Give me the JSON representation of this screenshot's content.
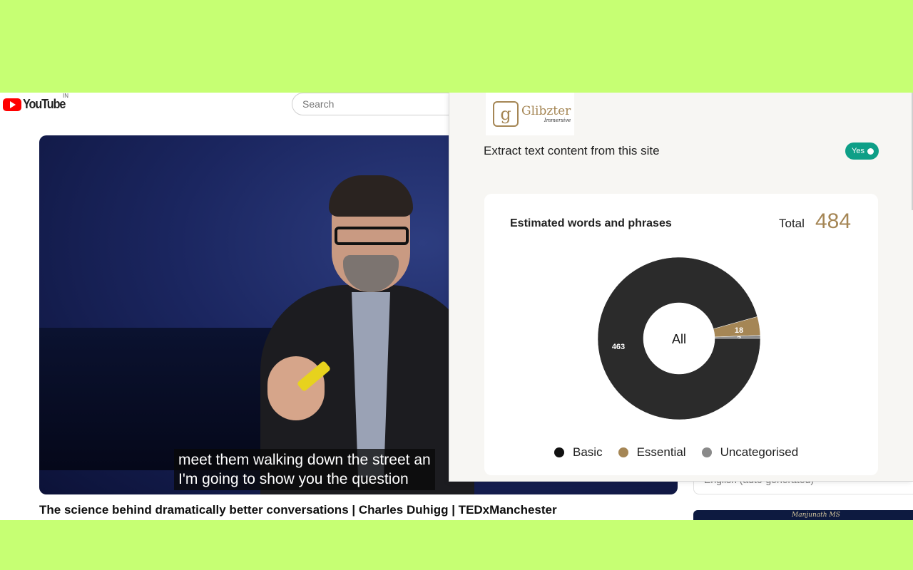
{
  "youtube": {
    "logo_text": "YouTube",
    "country_code": "IN",
    "search_placeholder": "Search"
  },
  "video": {
    "captions": [
      "meet them walking down the street an",
      "I'm going to show you the question"
    ],
    "title": "The science behind dramatically better conversations | Charles Duhigg | TEDxManchester"
  },
  "sidebar": {
    "subtitle_select": "English (auto-generated)",
    "thumbnail_text": "Manjunath MS"
  },
  "panel": {
    "brand_name": "Glibzter",
    "brand_sub": "Immersive",
    "brand_mark": "g",
    "extract_label": "Extract text content from this site",
    "toggle_label": "Yes",
    "toggle_color": "#0e9f87",
    "card_title": "Estimated words and phrases",
    "total_label": "Total",
    "total_value": "484",
    "center_label": "All"
  },
  "chart_data": {
    "type": "pie",
    "style": "donut",
    "total": 484,
    "center_label": "All",
    "categories": [
      "Basic",
      "Essential",
      "Uncategorised"
    ],
    "values": [
      463,
      18,
      3
    ],
    "colors": [
      "#2b2b2b",
      "#a58655",
      "#8a8a8a"
    ],
    "legend_dot_colors": [
      "#111111",
      "#a58655",
      "#8a8a8a"
    ],
    "legend_position": "bottom"
  }
}
